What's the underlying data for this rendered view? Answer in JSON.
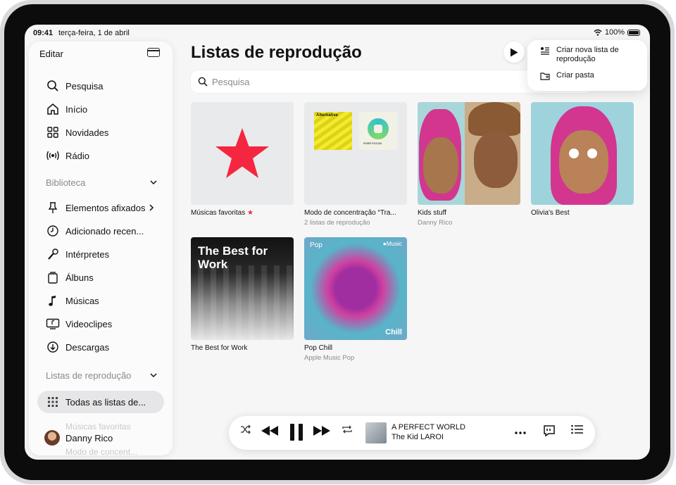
{
  "status": {
    "time": "09:41",
    "date": "terça-feira, 1 de abril",
    "battery": "100%"
  },
  "sidebar": {
    "edit_label": "Editar",
    "items": [
      {
        "label": "Pesquisa",
        "icon": "search-icon"
      },
      {
        "label": "Início",
        "icon": "home-icon"
      },
      {
        "label": "Novidades",
        "icon": "grid-icon"
      },
      {
        "label": "Rádio",
        "icon": "radio-icon"
      }
    ],
    "library_header": "Biblioteca",
    "library": [
      {
        "label": "Elementos afixados",
        "icon": "pin-icon"
      },
      {
        "label": "Adicionado recen...",
        "icon": "clock-icon"
      },
      {
        "label": "Intérpretes",
        "icon": "microphone-icon"
      },
      {
        "label": "Álbuns",
        "icon": "album-icon"
      },
      {
        "label": "Músicas",
        "icon": "music-note-icon"
      },
      {
        "label": "Videoclipes",
        "icon": "video-icon"
      },
      {
        "label": "Descargas",
        "icon": "download-icon"
      }
    ],
    "playlists_header": "Listas de reprodução",
    "all_playlists": "Todas as listas de...",
    "faded": [
      "Músicas favoritas",
      "Modo de concent..."
    ],
    "user": "Danny Rico"
  },
  "main": {
    "title": "Listas de reprodução",
    "search_placeholder": "Pesquisa"
  },
  "menu": {
    "new_playlist": "Criar nova lista de reprodução",
    "new_folder": "Criar pasta"
  },
  "playlists": [
    {
      "title": "Músicas favoritas",
      "star": "★"
    },
    {
      "title": "Modo de concentração “Tra...",
      "subtitle": "2 listas de reprodução",
      "covers": {
        "a": "Alternative",
        "b": "PURE FOCUS"
      }
    },
    {
      "title": "Kids stuff",
      "subtitle": "Danny Rico"
    },
    {
      "title": "Olivia's Best"
    },
    {
      "title": "The Best for Work",
      "cover_text": "The Best for Work"
    },
    {
      "title": "Pop Chill",
      "subtitle": "Apple Music Pop",
      "cover_label": "Pop",
      "cover_brand": "Music",
      "cover_tag": "Chill"
    }
  ],
  "player": {
    "song": "A PERFECT WORLD",
    "artist": "The Kid LAROI"
  },
  "colors": {
    "accent": "#f5263f",
    "background": "#f6f6f7"
  }
}
